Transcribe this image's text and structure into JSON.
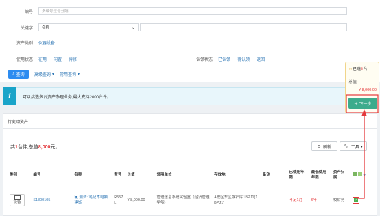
{
  "filters": {
    "number_label": "编号",
    "number_placeholder": "多编号逗号分隔",
    "keyword_label": "关键字",
    "keyword_select": "名称",
    "category_label": "资产类别",
    "category_value": "仪器设备",
    "use_status_label": "使用状态",
    "use_status_options": [
      "在用",
      "闲置",
      "待修"
    ],
    "claim_status_label": "认领状态",
    "claim_status_options": [
      "已认领",
      "待认领",
      "退回"
    ],
    "search_button": "查询",
    "advanced_link": "高级查询",
    "common_link": "常用查询"
  },
  "notice": {
    "icon": "i",
    "text": "可以挑选多台资产办理业务,最大支持2000台件。"
  },
  "section": {
    "title": "待变动资产"
  },
  "summary": {
    "prefix": "共",
    "count": "1",
    "mid": "台件,总值",
    "total": "8,000",
    "suffix": "元。",
    "refresh_button": "刷新",
    "tools_button": "工具"
  },
  "table": {
    "headers": [
      "类别",
      "编号",
      "名称",
      "型号",
      "价值",
      "领用单位",
      "存放地",
      "备注",
      "已使用年限",
      "最低使用年限",
      "资产归属"
    ],
    "row": {
      "category": "设备",
      "number": "S1800105",
      "name": "测试: 笔记本电脑建饰",
      "model": "R557L",
      "value": "¥ 8,000.00",
      "unit": "管理信息系统实验室（经济管理学院）",
      "location": "A校区东区钢铲库1BPJ1(1BPJ1)",
      "remark": "",
      "used_years": "不足1月",
      "min_years": "6年",
      "ownership": "校财务"
    }
  },
  "cart": {
    "selected_prefix": "已选",
    "selected_count": "1",
    "selected_suffix": "台",
    "total_label": "总值:",
    "total_value": "¥ 8,000.00",
    "next_button": "下一步"
  },
  "colors": {
    "primary": "#2d8cf0",
    "red": "#e4393c",
    "teal_button": "#3cab8c",
    "notice_bg": "#e8f6fb",
    "notice_icon": "#1aa4c9"
  }
}
